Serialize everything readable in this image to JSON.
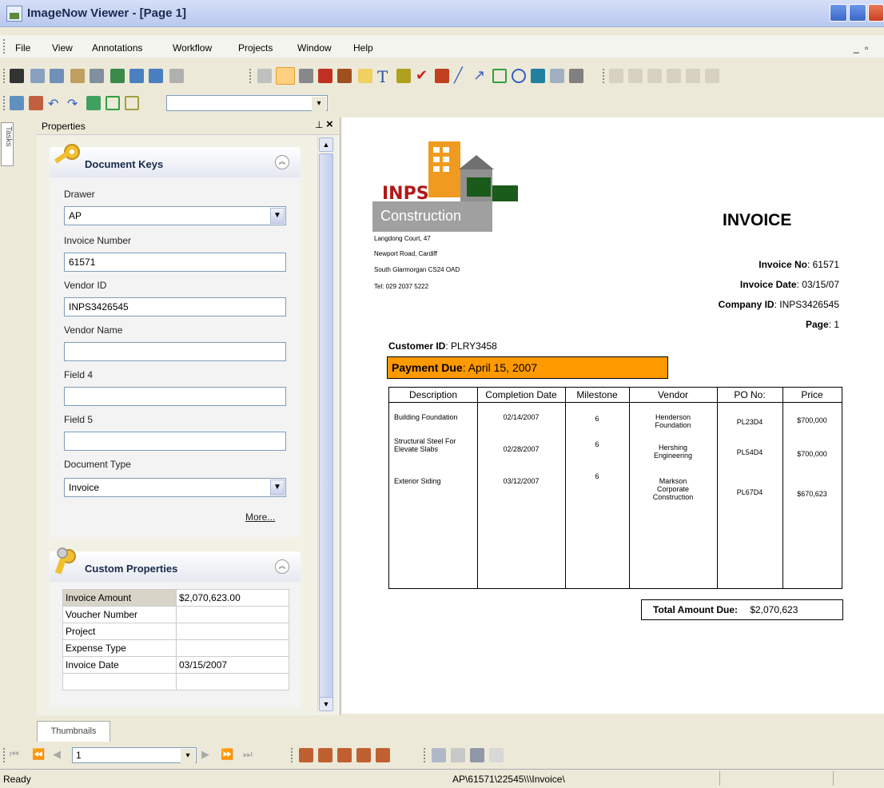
{
  "window": {
    "title": "ImageNow Viewer - [Page 1]"
  },
  "menu": [
    "File",
    "View",
    "Annotations",
    "Workflow",
    "Projects",
    "Window",
    "Help"
  ],
  "side_tab": "Tasks",
  "properties_panel": {
    "title": "Properties",
    "pin_icon": "ᵖ",
    "close_icon": "×",
    "document_keys": {
      "title": "Document Keys",
      "fields": [
        {
          "label": "Drawer",
          "value": "AP",
          "type": "select"
        },
        {
          "label": "Invoice Number",
          "value": "61571",
          "type": "text"
        },
        {
          "label": "Vendor ID",
          "value": "INPS3426545",
          "type": "text"
        },
        {
          "label": "Vendor Name",
          "value": "",
          "type": "text"
        },
        {
          "label": "Field 4",
          "value": "",
          "type": "text"
        },
        {
          "label": "Field 5",
          "value": "",
          "type": "text"
        },
        {
          "label": "Document Type",
          "value": "Invoice",
          "type": "select"
        }
      ],
      "more_link": "More..."
    },
    "custom_properties": {
      "title": "Custom Properties",
      "rows": [
        {
          "key": "Invoice Amount",
          "value": "$2,070,623.00"
        },
        {
          "key": "Voucher Number",
          "value": ""
        },
        {
          "key": "Project",
          "value": ""
        },
        {
          "key": "Expense Type",
          "value": ""
        },
        {
          "key": "Invoice Date",
          "value": "03/15/2007"
        }
      ]
    }
  },
  "document": {
    "company_logo_top": "INPS",
    "company_logo_bottom": "Construction",
    "heading": "INVOICE",
    "address": [
      "Langdong Court, 47",
      "Newport Road, Cardiff",
      "South Glarmorgan CS24 OAD",
      "Tel: 029 2037 5222"
    ],
    "invoice_no_label": "Invoice No",
    "invoice_no": ": 61571",
    "invoice_date_label": "Invoice Date",
    "invoice_date": ": 03/15/07",
    "company_id_label": "Company ID",
    "company_id": ": INPS3426545",
    "page_label": "Page",
    "page": ": 1",
    "customer_id_label": "Customer ID",
    "customer_id": ": PLRY3458",
    "payment_due_label": "Payment Due",
    "payment_due": ": April 15, 2007",
    "table_headers": [
      "Description",
      "Completion Date",
      "Milestone",
      "Vendor",
      "PO No:",
      "Price"
    ],
    "rows": [
      {
        "desc": "Building Foundation",
        "date": "02/14/2007",
        "milestone": "6",
        "vendor": "Henderson\nFoundation",
        "po": "PL23D4",
        "price": "$700,000"
      },
      {
        "desc": "Structural Steel For\nElevate Slabs",
        "date": "02/28/2007",
        "milestone": "6",
        "vendor": "Hershing\nEngineering",
        "po": "PL54D4",
        "price": "$700,000"
      },
      {
        "desc": "Exterior Siding",
        "date": "03/12/2007",
        "milestone": "6",
        "vendor": "Markson\nCorporate\nConstruction",
        "po": "PL67D4",
        "price": "$670,623"
      }
    ],
    "total_label": "Total Amount Due:",
    "total_value": "$2,070,623"
  },
  "bottom": {
    "thumbnails_tab": "Thumbnails",
    "page_field": "1"
  },
  "status": {
    "left": "Ready",
    "path": "AP\\61571\\22545\\\\\\Invoice\\"
  },
  "colors": {
    "payment_bar": "#ff9900",
    "logo_grey": "#a0a0a0",
    "inps_red": "#b01818"
  }
}
